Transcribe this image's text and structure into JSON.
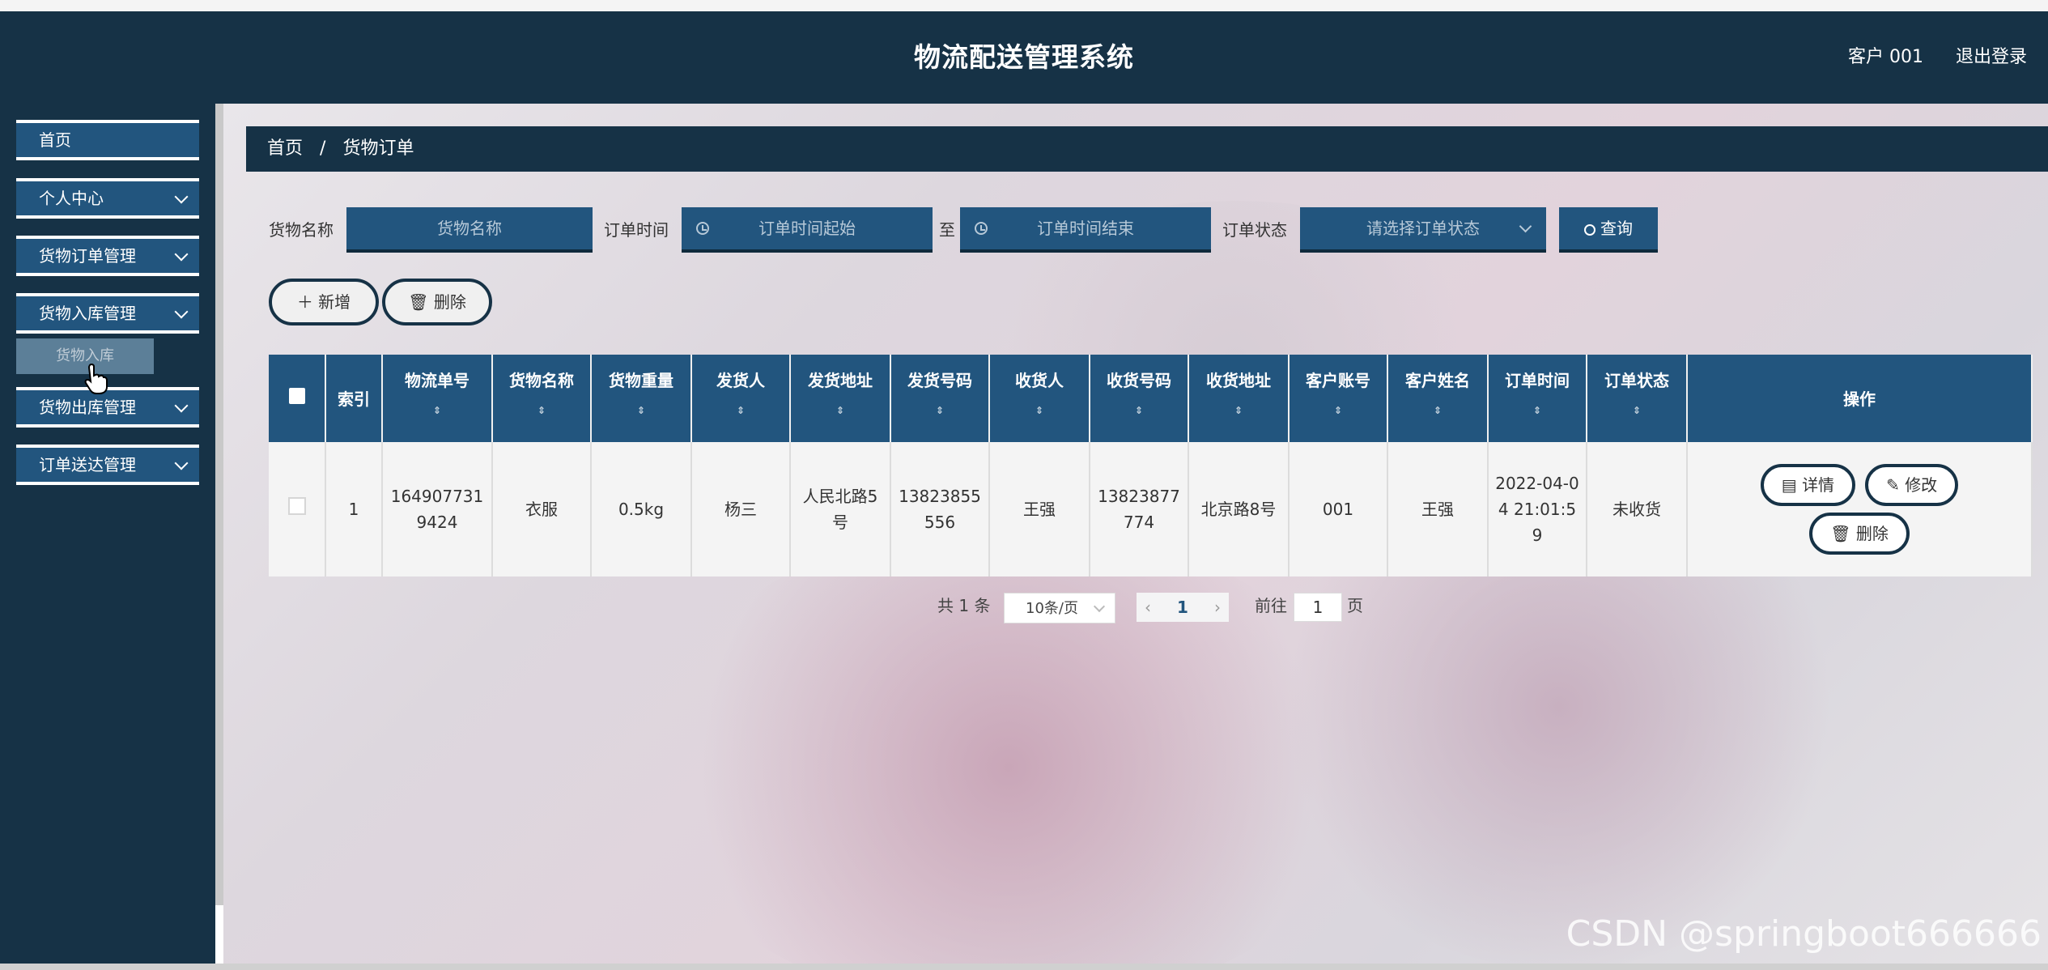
{
  "header": {
    "title": "物流配送管理系统",
    "user": "客户 001",
    "logout": "退出登录"
  },
  "sidebar": {
    "items": [
      {
        "label": "首页"
      },
      {
        "label": "个人中心"
      },
      {
        "label": "货物订单管理"
      },
      {
        "label": "货物入库管理"
      },
      {
        "label": "货物出库管理"
      },
      {
        "label": "订单送达管理"
      }
    ],
    "submenu": {
      "label": "货物入库"
    }
  },
  "breadcrumb": {
    "home": "首页",
    "separator": "/",
    "current": "货物订单"
  },
  "search": {
    "name_label": "货物名称",
    "name_placeholder": "货物名称",
    "time_label": "订单时间",
    "time_start_placeholder": "订单时间起始",
    "time_to": "至",
    "time_end_placeholder": "订单时间结束",
    "status_label": "订单状态",
    "status_placeholder": "请选择订单状态",
    "query_label": "查询"
  },
  "actions": {
    "add_label": "新增",
    "delete_label": "删除"
  },
  "table": {
    "headers": [
      "索引",
      "物流单号",
      "货物名称",
      "货物重量",
      "发货人",
      "发货地址",
      "发货号码",
      "收货人",
      "收货号码",
      "收货地址",
      "客户账号",
      "客户姓名",
      "订单时间",
      "订单状态",
      "操作"
    ],
    "sort_icon": "⇕",
    "rows": [
      {
        "cells": [
          "1",
          "1649077319424",
          "衣服",
          "0.5kg",
          "杨三",
          "人民北路5号",
          "13823855556",
          "王强",
          "13823877774",
          "北京路8号",
          "001",
          "王强",
          "2022-04-04 21:01:59",
          "未收货"
        ],
        "ops": {
          "detail": "详情",
          "edit": "修改",
          "delete": "删除"
        }
      }
    ]
  },
  "pagination": {
    "total_text": "共 1 条",
    "page_size": "10条/页",
    "current_page": "1",
    "goto_label": "前往",
    "goto_value": "1",
    "page_unit": "页"
  },
  "watermark": "CSDN @springboot666666",
  "colors": {
    "header_bg": "#163246",
    "accent": "#22557e"
  }
}
